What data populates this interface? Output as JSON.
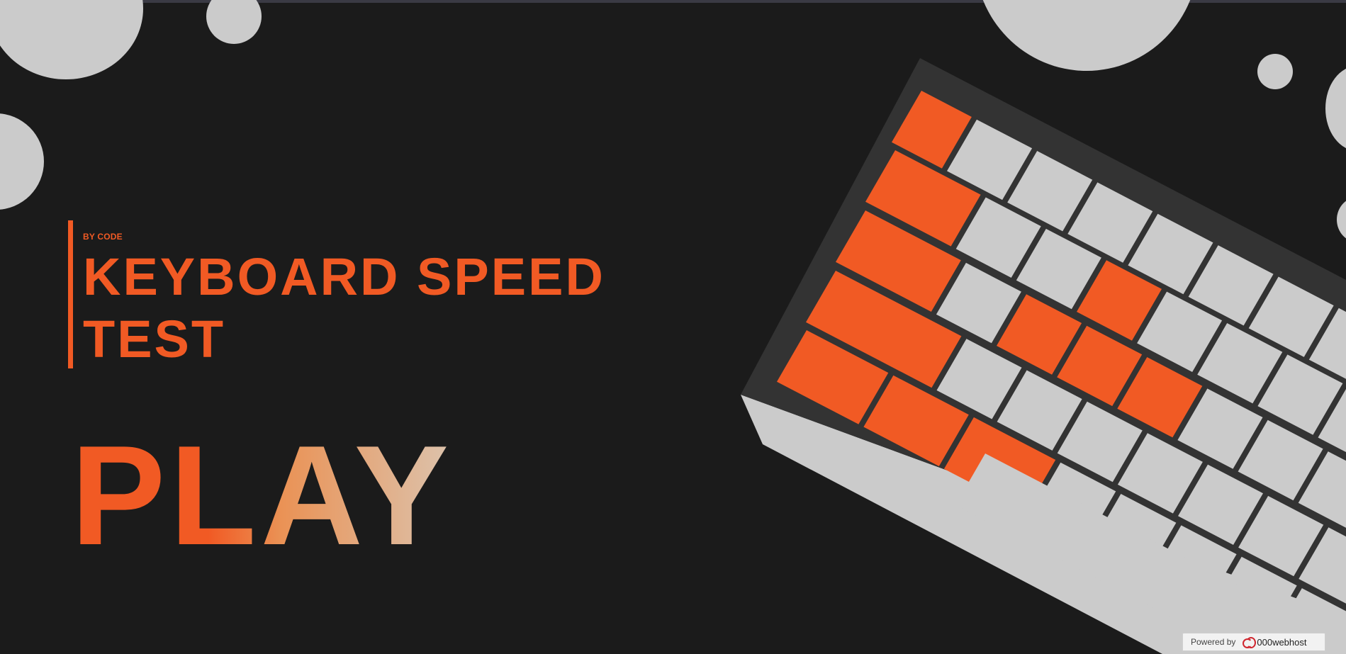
{
  "header": {
    "byline": "BY CODE",
    "title_line1": "KEYBOARD SPEED",
    "title_line2": "TEST"
  },
  "main": {
    "play_label": "PLAY"
  },
  "footer": {
    "powered_label": "Powered by",
    "brand_label": "000webhost",
    "brand_icon": "000webhost-logo-icon"
  },
  "colors": {
    "background": "#1b1b1b",
    "accent": "#f15a24",
    "key_light": "#cbcbcb",
    "keyboard_frame": "#333333"
  },
  "keyboard": {
    "rows": [
      [
        "orange",
        "gray",
        "gray",
        "gray",
        "gray",
        "gray",
        "gray",
        "gray",
        "gray"
      ],
      [
        "orange",
        "gray",
        "gray",
        "orange",
        "gray",
        "gray",
        "gray",
        "gray"
      ],
      [
        "orange",
        "gray",
        "orange",
        "orange",
        "orange",
        "gray",
        "gray",
        "gray"
      ],
      [
        "orange",
        "gray",
        "gray",
        "gray",
        "gray",
        "gray",
        "gray",
        "gray"
      ],
      [
        "orange",
        "orange",
        "orange",
        "gray",
        "gray",
        "gray",
        "gray",
        "gray"
      ]
    ]
  }
}
